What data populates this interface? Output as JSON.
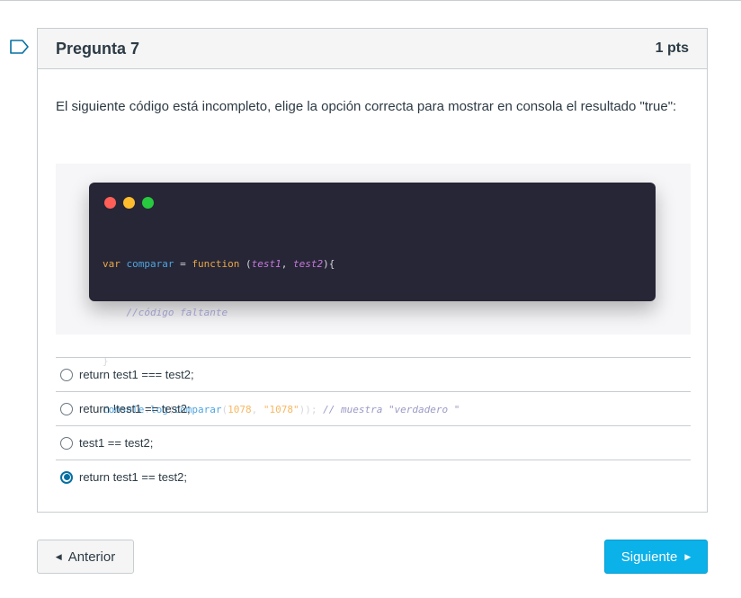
{
  "question": {
    "title": "Pregunta 7",
    "points": "1 pts",
    "text": "El siguiente código está incompleto, elige la opción correcta para mostrar en consola el resultado \"true\":"
  },
  "code": {
    "window_dot_colors": [
      "#ff5f56",
      "#ffbd2e",
      "#27c93f"
    ],
    "line1": {
      "kw": "var",
      "name": "comparar",
      "eq": " = ",
      "fn_kw": "function",
      "open": " (",
      "p1": "test1",
      "comma": ", ",
      "p2": "test2",
      "close": "){"
    },
    "line2": {
      "comment": "    //código faltante"
    },
    "line3": {
      "brace": "}"
    },
    "line4": {
      "obj": "console",
      "dot": ".",
      "method": "log",
      "open": "(",
      "call": "comparar",
      "open2": "(",
      "num": "1078",
      "comma": ", ",
      "str": "\"1078\"",
      "close": "));",
      "comment": " // muestra \"verdadero \""
    }
  },
  "answers": [
    {
      "label": "return test1 === test2;",
      "selected": false
    },
    {
      "label": "return !test1 == test2;",
      "selected": false
    },
    {
      "label": "test1 == test2;",
      "selected": false
    },
    {
      "label": "return test1 == test2;",
      "selected": true
    }
  ],
  "nav": {
    "prev_label": "Anterior",
    "next_label": "Siguiente",
    "prev_icon": "triangle-left-icon",
    "next_icon": "triangle-right-icon"
  },
  "colors": {
    "accent": "#0bb1e9",
    "radio_selected": "#0770a3",
    "code_bg": "#272636"
  }
}
